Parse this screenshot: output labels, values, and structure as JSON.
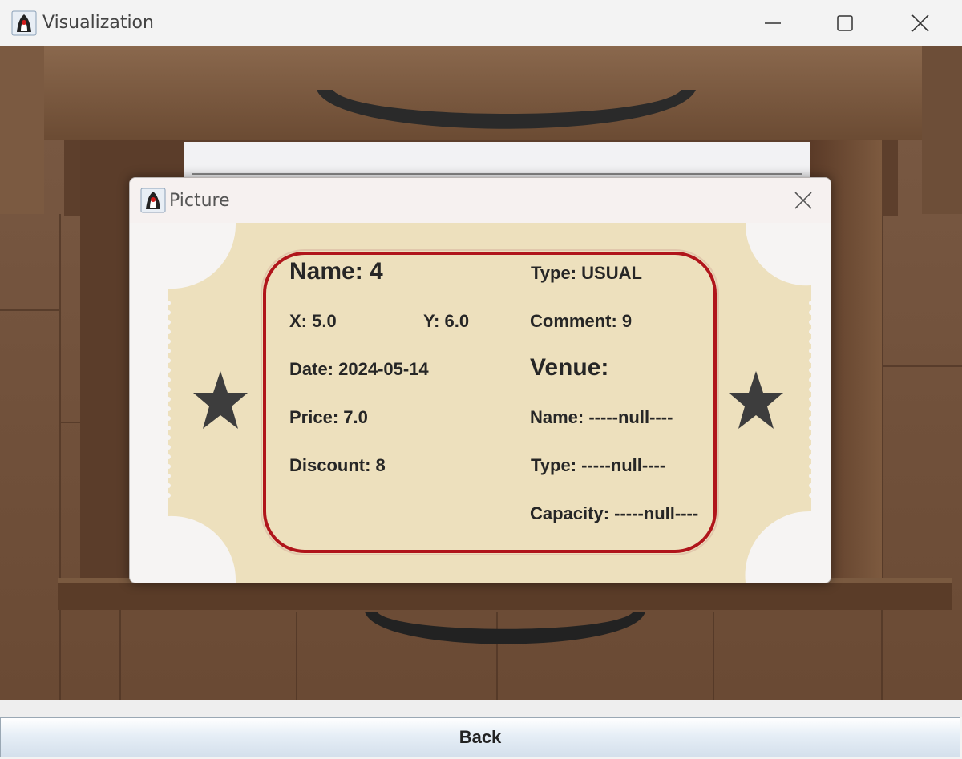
{
  "window": {
    "title": "Visualization",
    "icon": "java-duke-icon"
  },
  "dialog": {
    "title": "Picture",
    "icon": "java-duke-icon"
  },
  "ticket": {
    "name": "Name: 4",
    "x": "X: 5.0",
    "y": "Y: 6.0",
    "date": "Date: 2024-05-14",
    "price": "Price: 7.0",
    "discount": "Discount: 8",
    "type": "Type: USUAL",
    "comment": "Comment: 9",
    "venue_heading": "Venue:",
    "venue_name": "Name: -----null----",
    "venue_type": "Type: -----null----",
    "venue_capacity": "Capacity: -----null----"
  },
  "buttons": {
    "back": "Back"
  },
  "colors": {
    "ticket_paper": "#ede0bd",
    "ticket_border": "#b0151b",
    "star": "#3d3d3d",
    "wood": "#6e4a32"
  }
}
